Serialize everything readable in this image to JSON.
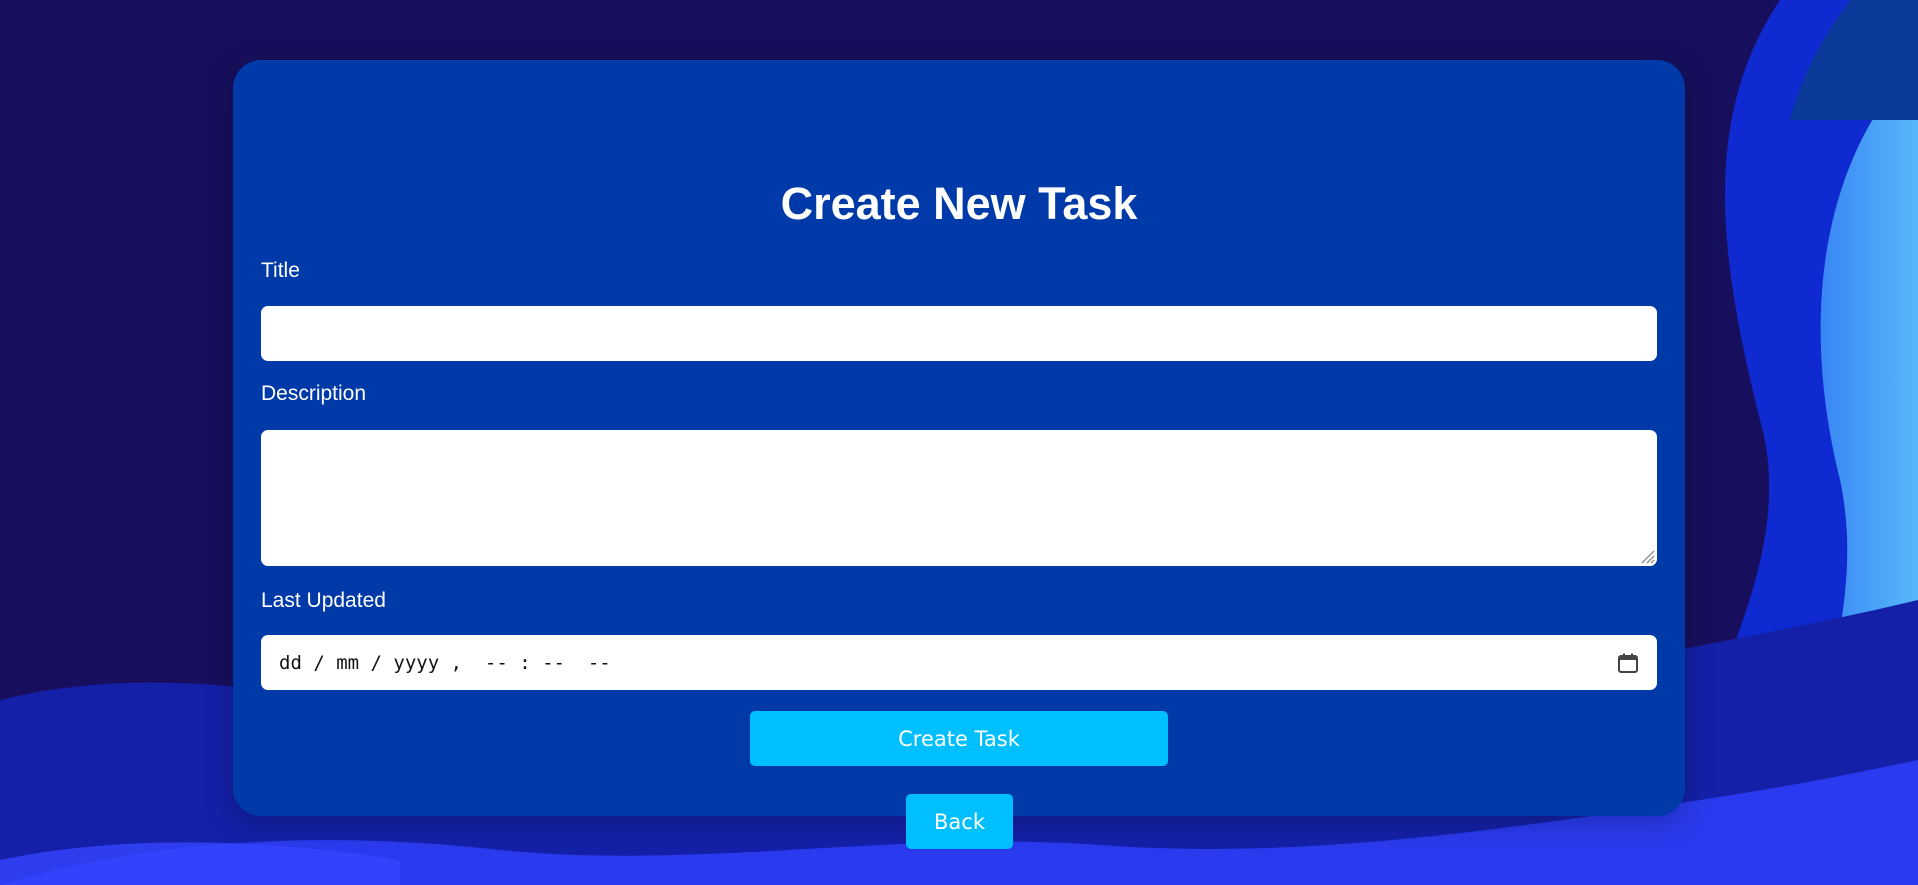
{
  "form": {
    "heading": "Create New Task",
    "title_label": "Title",
    "title_value": "",
    "description_label": "Description",
    "description_value": "",
    "last_updated_label": "Last Updated",
    "last_updated_placeholder": "dd / mm / yyyy ,  -- : --  --",
    "calendar_icon": "calendar-icon"
  },
  "actions": {
    "create_label": "Create Task",
    "back_label": "Back"
  },
  "colors": {
    "background": "#170f5e",
    "card": "#0039a8",
    "button": "#00bfff",
    "text": "#ffffff"
  }
}
